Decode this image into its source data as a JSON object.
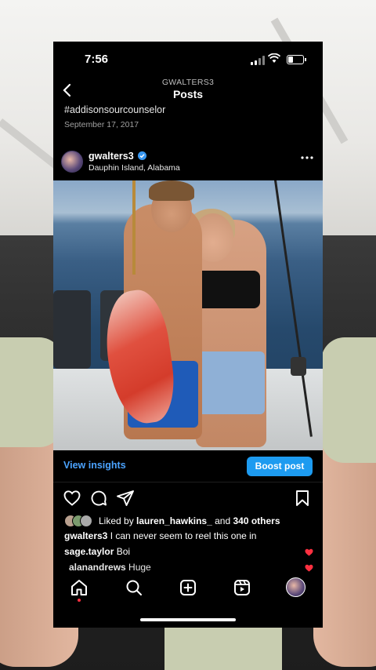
{
  "status_bar": {
    "time": "7:56"
  },
  "header": {
    "username": "GWALTERS3",
    "title": "Posts"
  },
  "previous_post": {
    "caption": "#addisonsourcounselor",
    "date": "September 17, 2017"
  },
  "post": {
    "username": "gwalters3",
    "location": "Dauphin Island, Alabama",
    "view_insights_label": "View insights",
    "boost_label": "Boost post",
    "liked_by_prefix": "Liked by",
    "liked_by_user": "lauren_hawkins_",
    "liked_by_and": "and",
    "liked_by_others": "340 others",
    "caption_user": "gwalters3",
    "caption_text": "I can never seem to reel this one in",
    "comments": [
      {
        "user": "sage.taylor",
        "text": "Boi"
      },
      {
        "user": "alanandrews",
        "text": "Huge"
      }
    ]
  },
  "colors": {
    "link_blue": "#4ba3ff",
    "boost_blue": "#1d9bf0",
    "heart_red": "#ff3040",
    "verified_blue": "#3897f0"
  },
  "icons": {
    "back": "chevron-left-icon",
    "more": "more-horizontal-icon",
    "like": "heart-icon",
    "comment": "comment-icon",
    "share": "send-icon",
    "save": "bookmark-icon",
    "tabs": [
      "home-icon",
      "search-icon",
      "add-post-icon",
      "reels-icon",
      "profile-avatar"
    ]
  }
}
